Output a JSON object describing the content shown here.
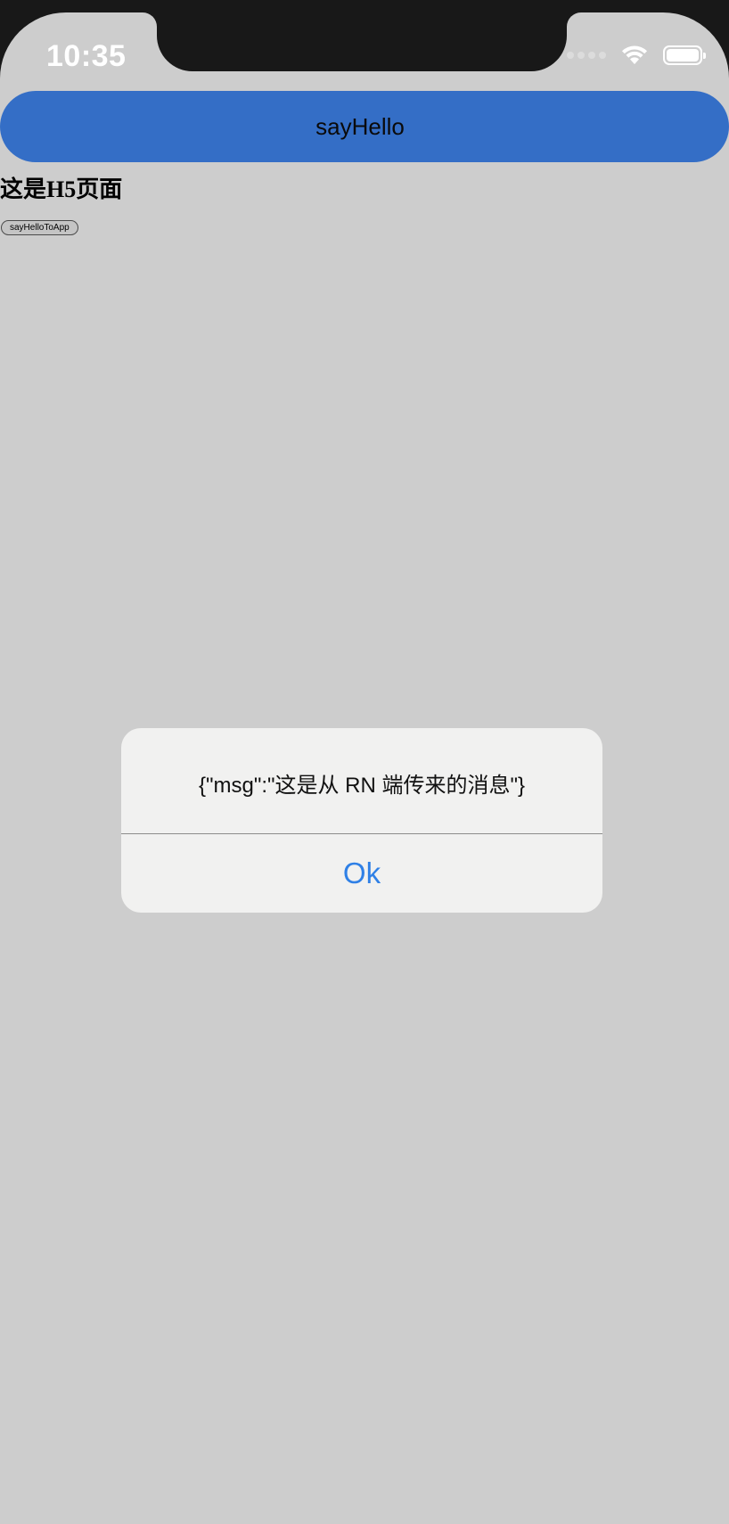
{
  "status_bar": {
    "time": "10:35",
    "icons": [
      "signal-icon",
      "wifi-icon",
      "battery-icon"
    ]
  },
  "top_button": {
    "label": "sayHello"
  },
  "webview": {
    "title": "这是H5页面",
    "button_label": "sayHelloToApp"
  },
  "alert": {
    "message": "{\"msg\":\"这是从 RN 端传来的消息\"}",
    "ok_label": "Ok"
  },
  "colors": {
    "accent_blue": "#346ec6",
    "alert_button": "#2f80e6",
    "background": "#cdcdcd"
  }
}
